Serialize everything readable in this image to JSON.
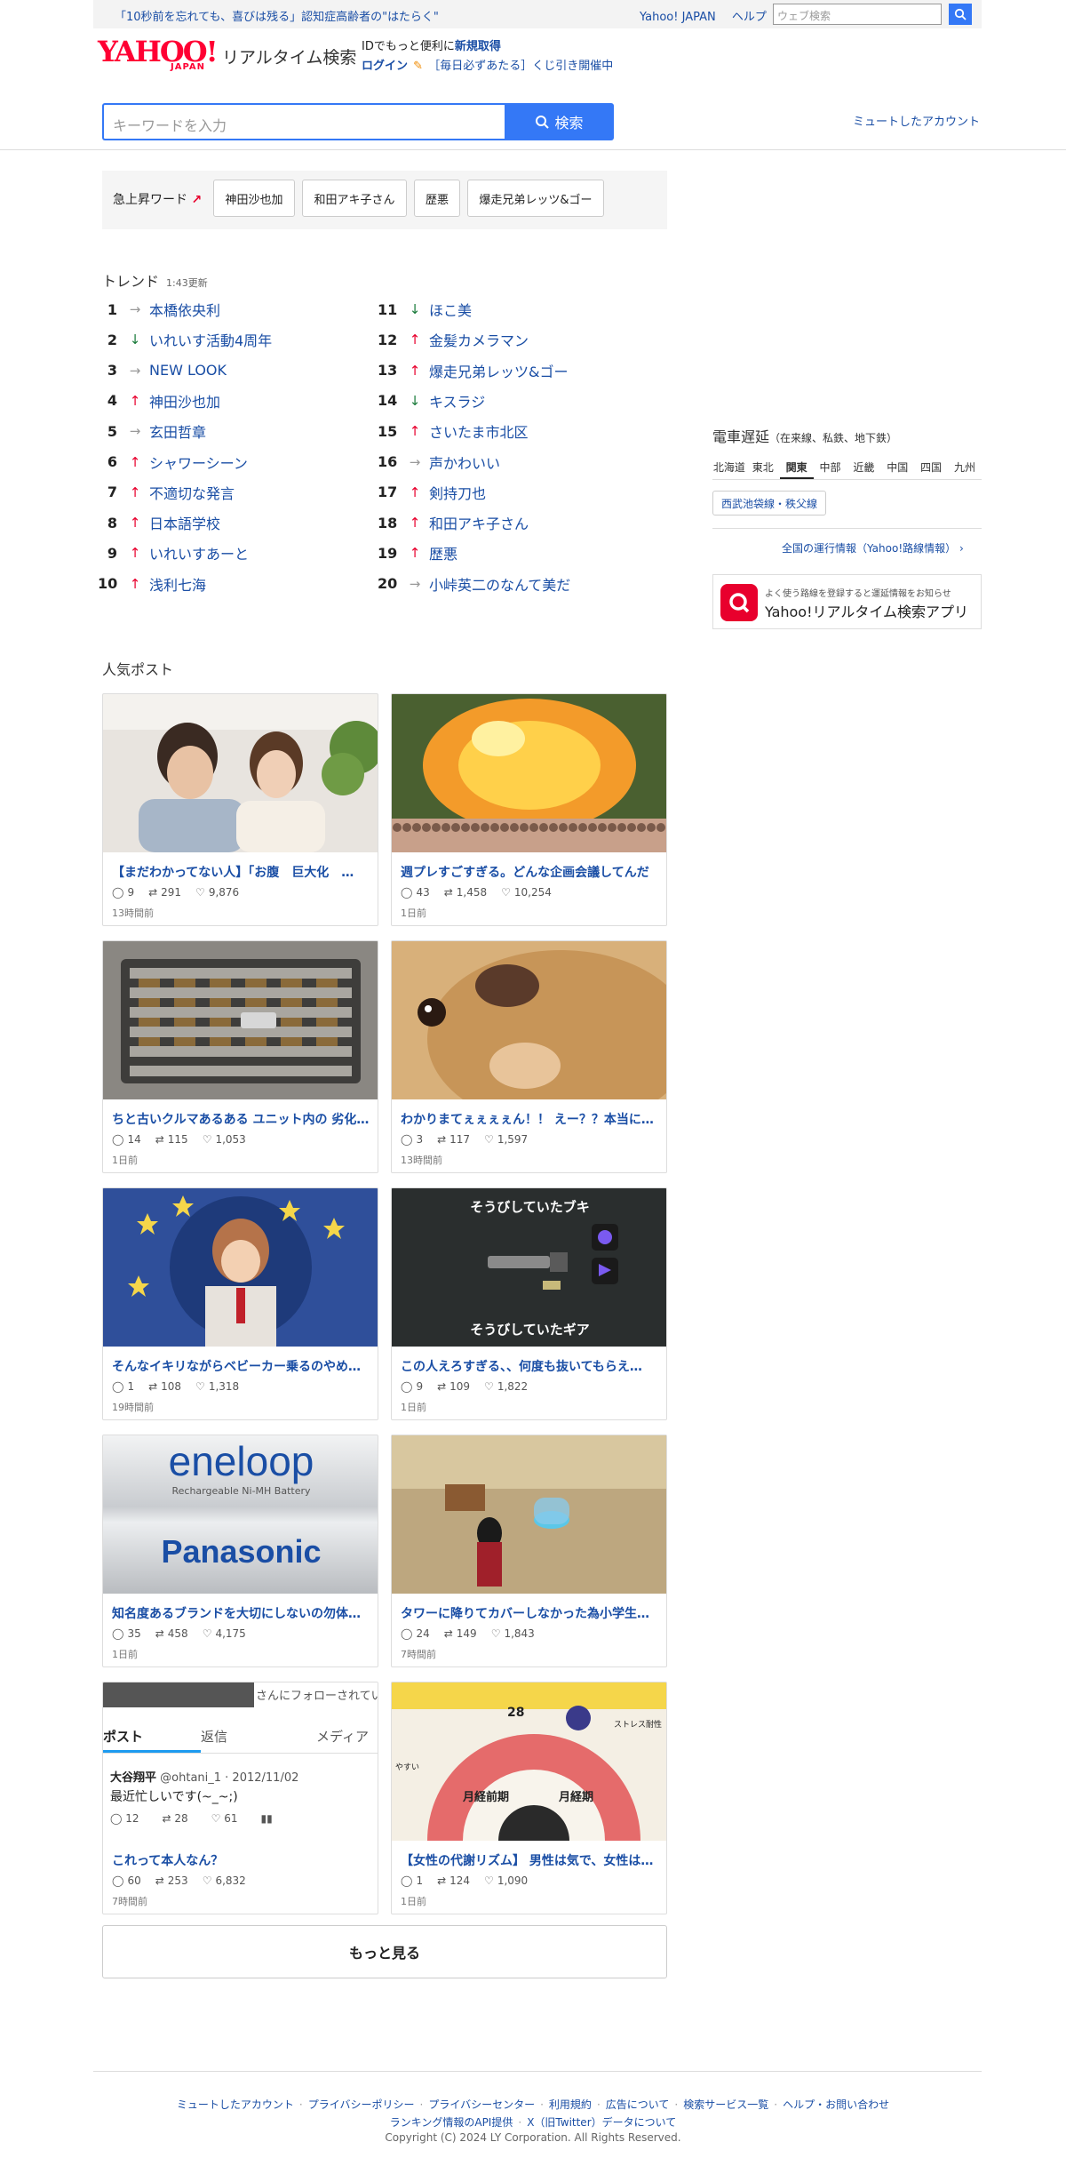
{
  "topbar": {
    "notice": "「10秒前を忘れても、喜びは残る」認知症高齢者の\"はたらく\"",
    "links": [
      "Yahoo! JAPAN",
      "ヘルプ"
    ],
    "web_search_placeholder": "ウェブ検索"
  },
  "header": {
    "logo_text": "YAHOO!",
    "logo_sub": "JAPAN",
    "service_name": "リアルタイム検索",
    "info_line1_prefix": "IDでもっと便利に",
    "info_line1_link": "新規取得",
    "info_line2_login": "ログイン",
    "info_line2_promo": "［毎日必ずあたる］くじ引き開催中",
    "muted_accounts": "ミュートしたアカウント"
  },
  "search": {
    "placeholder": "キーワードを入力",
    "button_label": "検索"
  },
  "rising": {
    "label": "急上昇ワード",
    "words": [
      "神田沙也加",
      "和田アキ子さん",
      "歴悪",
      "爆走兄弟レッツ&ゴー"
    ]
  },
  "trend": {
    "title": "トレンド",
    "updated": "1:43更新",
    "items": [
      {
        "rank": "1",
        "dir": "flat",
        "name": "本橋依央利"
      },
      {
        "rank": "2",
        "dir": "down",
        "name": "いれいす活動4周年"
      },
      {
        "rank": "3",
        "dir": "flat",
        "name": "NEW LOOK"
      },
      {
        "rank": "4",
        "dir": "up",
        "name": "神田沙也加"
      },
      {
        "rank": "5",
        "dir": "flat",
        "name": "玄田哲章"
      },
      {
        "rank": "6",
        "dir": "up",
        "name": "シャワーシーン"
      },
      {
        "rank": "7",
        "dir": "up",
        "name": "不適切な発言"
      },
      {
        "rank": "8",
        "dir": "up",
        "name": "日本語学校"
      },
      {
        "rank": "9",
        "dir": "up",
        "name": "いれいすあーと"
      },
      {
        "rank": "10",
        "dir": "up",
        "name": "浅利七海"
      },
      {
        "rank": "11",
        "dir": "down",
        "name": "ほこ美"
      },
      {
        "rank": "12",
        "dir": "up",
        "name": "金髪カメラマン"
      },
      {
        "rank": "13",
        "dir": "up",
        "name": "爆走兄弟レッツ&ゴー"
      },
      {
        "rank": "14",
        "dir": "down",
        "name": "キスラジ"
      },
      {
        "rank": "15",
        "dir": "up",
        "name": "さいたま市北区"
      },
      {
        "rank": "16",
        "dir": "flat",
        "name": "声かわいい"
      },
      {
        "rank": "17",
        "dir": "up",
        "name": "剣持刀也"
      },
      {
        "rank": "18",
        "dir": "up",
        "name": "和田アキ子さん"
      },
      {
        "rank": "19",
        "dir": "up",
        "name": "歴悪"
      },
      {
        "rank": "20",
        "dir": "flat",
        "name": "小峠英二のなんて美だ"
      }
    ]
  },
  "popular": {
    "title": "人気ポスト",
    "posts": [
      {
        "title": "【まだわかってない人】「お腹　巨大化　…",
        "replies": "9",
        "reposts": "291",
        "likes": "9,876",
        "ago": "13時間前",
        "img_color": "#c9b8a2"
      },
      {
        "title": "週プレすごすぎる。どんな企画会議してんだ",
        "replies": "43",
        "reposts": "1,458",
        "likes": "10,254",
        "ago": "1日前",
        "img_color": "#d9692a"
      },
      {
        "title": "ちと古いクルマあるある ユニット内の 劣化…",
        "replies": "14",
        "reposts": "115",
        "likes": "1,053",
        "ago": "1日前",
        "img_color": "#6e6a66"
      },
      {
        "title": "わかりまてぇぇぇぇん！！ えー？？本当に…",
        "replies": "3",
        "reposts": "117",
        "likes": "1,597",
        "ago": "13時間前",
        "img_color": "#c69663"
      },
      {
        "title": "そんなイキリながらベビーカー乗るのやめ…",
        "replies": "1",
        "reposts": "108",
        "likes": "1,318",
        "ago": "19時間前",
        "img_color": "#3a5aa8"
      },
      {
        "title": "この人えろすぎる、、何度も抜いてもらえ…",
        "replies": "9",
        "reposts": "109",
        "likes": "1,822",
        "ago": "1日前",
        "img_color": "#2a2e2e"
      },
      {
        "title": "知名度あるブランドを大切にしないの勿体…",
        "replies": "35",
        "reposts": "458",
        "likes": "4,175",
        "ago": "1日前",
        "img_color": "#dde0e3"
      },
      {
        "title": "タワーに降りてカバーしなかった為小学生…",
        "replies": "24",
        "reposts": "149",
        "likes": "1,843",
        "ago": "7時間前",
        "img_color": "#a08e6a"
      },
      {
        "title": "これって本人なん？",
        "replies": "60",
        "reposts": "253",
        "likes": "6,832",
        "ago": "7時間前",
        "img_color": "#ffffff"
      },
      {
        "title": "【女性の代謝リズム】 男性は気で、女性は…",
        "replies": "1",
        "reposts": "124",
        "likes": "1,090",
        "ago": "1日前",
        "img_color": "#e56b6b"
      }
    ],
    "more_label": "もっと見る"
  },
  "embedded_post": {
    "follow_text": "さんにフォローされてい",
    "tabs": [
      "ポスト",
      "返信",
      "メディア"
    ],
    "author": "大谷翔平",
    "handle": "@ohtani_1 · 2012/11/02",
    "text": "最近忙しいです(~_~;)",
    "replies": "12",
    "reposts": "28",
    "likes": "61"
  },
  "image_text": {
    "spla_top": "そうびしていたブキ",
    "spla_bottom": "そうびしていたギア",
    "eneloop": "eneloop",
    "eneloop_sub": "Rechargeable Ni-MH Battery",
    "panasonic": "Panasonic",
    "cycle_num": "28",
    "cycle_a": "月経前期",
    "cycle_b": "月経期",
    "cycle_c": "ストレス耐性",
    "cycle_d": "やすい"
  },
  "train": {
    "title": "電車遅延",
    "subtitle": "（在来線、私鉄、地下鉄）",
    "regions": [
      "北海道",
      "東北",
      "関東",
      "中部",
      "近畿",
      "中国",
      "四国",
      "九州"
    ],
    "selected_region": "関東",
    "line": "西武池袋線・秩父線",
    "all_link": "全国の運行情報（Yahoo!路線情報）",
    "app_desc": "よく使う路線を登録すると運延情報をお知らせ",
    "app_name": "Yahoo!リアルタイム検索アプリ"
  },
  "footer": {
    "links_row1": [
      "ミュートしたアカウント",
      "プライバシーポリシー",
      "プライバシーセンター",
      "利用規約",
      "広告について",
      "検索サービス一覧",
      "ヘルプ・お問い合わせ"
    ],
    "links_row2": [
      "ランキング情報のAPI提供",
      "X（旧Twitter）データについて"
    ],
    "copyright": "Copyright (C) 2024 LY Corporation. All Rights Reserved."
  },
  "colors": {
    "accent": "#3478f6",
    "link": "#1a4ea5",
    "up": "#e8002d",
    "down": "#1a7a3a",
    "logo": "#ff0033"
  }
}
